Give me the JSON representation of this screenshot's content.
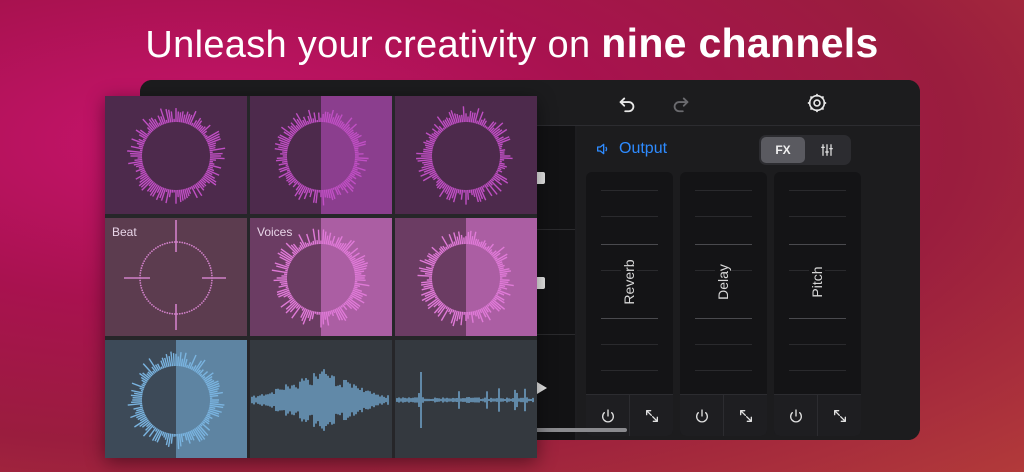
{
  "headline": {
    "regular": "Unleash your creativity on ",
    "bold": "nine channels"
  },
  "toolbar": {
    "undo_icon": "undo-icon",
    "redo_icon": "redo-icon",
    "settings_icon": "gear-icon"
  },
  "output": {
    "label": "Output",
    "icon": "speaker-icon",
    "tabs": [
      {
        "label": "FX",
        "active": true
      },
      {
        "label": "",
        "icon": "mixer-sliders-icon",
        "active": false
      }
    ],
    "effects": [
      {
        "label": "Reverb"
      },
      {
        "label": "Delay"
      },
      {
        "label": "Pitch"
      }
    ]
  },
  "channels": [
    {
      "label": "",
      "kind": "ring",
      "tint": "#4d2a4c",
      "accent": "#c04fc4",
      "sweep": 0
    },
    {
      "label": "",
      "kind": "ring",
      "tint": "#4d2a4c",
      "accent": "#c04fc4",
      "sweep": 0.5
    },
    {
      "label": "",
      "kind": "ring",
      "tint": "#4d2a4c",
      "accent": "#c04fc4",
      "sweep": 0
    },
    {
      "label": "Beat",
      "kind": "crosshair",
      "tint": "#5c3c4f",
      "accent": "#d080c8",
      "sweep": 0
    },
    {
      "label": "Voices",
      "kind": "ring",
      "tint": "#6b3c63",
      "accent": "#e07ad8",
      "sweep": 0.5
    },
    {
      "label": "",
      "kind": "ring",
      "tint": "#6b3c63",
      "accent": "#e07ad8",
      "sweep": 0.5
    },
    {
      "label": "",
      "kind": "ring",
      "tint": "#3d4a58",
      "accent": "#7ab4e0",
      "sweep": 0.5
    },
    {
      "label": "",
      "kind": "wave",
      "tint": "#34393f",
      "accent": "#7ab4e0",
      "sweep": 0
    },
    {
      "label": "",
      "kind": "spikes",
      "tint": "#34393f",
      "accent": "#7ab4e0",
      "sweep": 0
    }
  ],
  "colors": {
    "accent_blue": "#2e8bff"
  }
}
